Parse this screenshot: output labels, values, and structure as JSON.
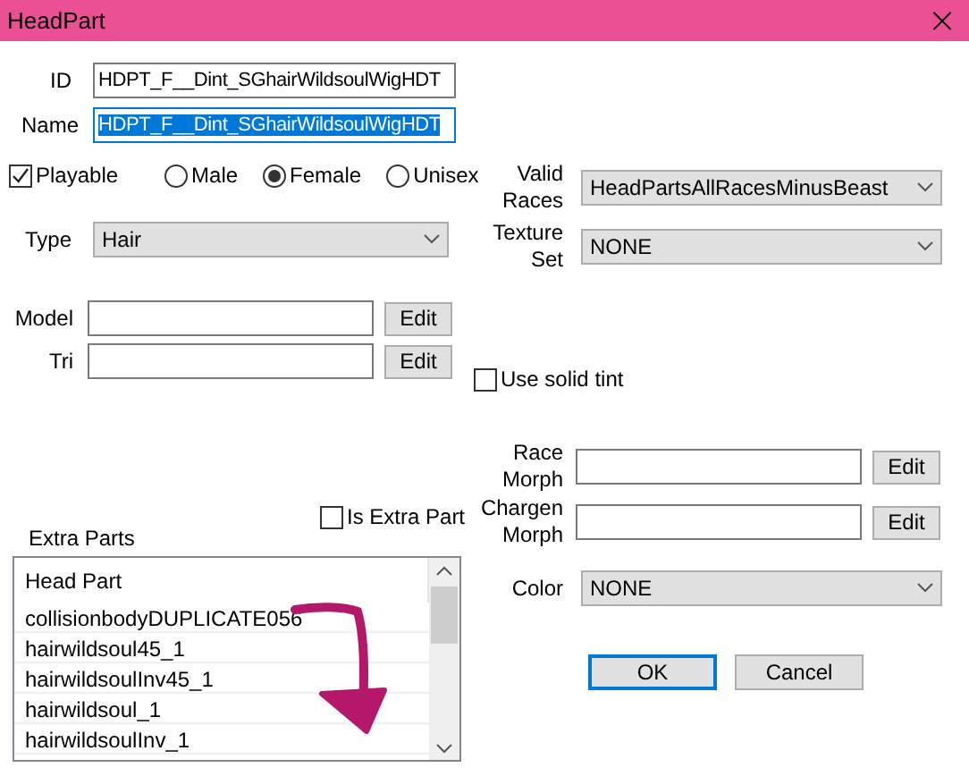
{
  "window": {
    "title": "HeadPart",
    "close": "×"
  },
  "id": {
    "label": "ID",
    "value": "HDPT_F__Dint_SGhairWildsoulWigHDT"
  },
  "name": {
    "label": "Name",
    "value": "HDPT_F__Dint_SGhairWildsoulWigHDT",
    "text_selected": true
  },
  "playable": {
    "label": "Playable",
    "checked": true
  },
  "sex": [
    {
      "label": "Male",
      "selected": false
    },
    {
      "label": "Female",
      "selected": true
    },
    {
      "label": "Unisex",
      "selected": false
    }
  ],
  "type": {
    "label": "Type",
    "value": "Hair"
  },
  "model": {
    "label": "Model",
    "button": "Edit"
  },
  "tri": {
    "label": "Tri",
    "button": "Edit"
  },
  "is_extra_part": {
    "label": "Is Extra Part",
    "checked": false
  },
  "extra_parts": {
    "label": "Extra Parts",
    "column": "Head Part",
    "rows": [
      {
        "text": "collisionbodyDUPLICATE056",
        "selected": false
      },
      {
        "text": "hairwildsoul45_1",
        "selected": false
      },
      {
        "text": "hairwildsoulInv45_1",
        "selected": false
      },
      {
        "text": "hairwildsoul_1",
        "selected": false
      },
      {
        "text": "hairwildsoulInv_1",
        "selected": false
      }
    ]
  },
  "valid_races": {
    "label": [
      "Valid",
      "Races"
    ],
    "value": "HeadPartsAllRacesMinusBeast"
  },
  "texture_set": {
    "label": [
      "Texture",
      "Set"
    ],
    "value": "NONE"
  },
  "use_solid_tint": {
    "label": "Use solid tint",
    "checked": false
  },
  "race_morph": {
    "label": [
      "Race",
      "Morph"
    ],
    "button": "Edit"
  },
  "chargen_morph": {
    "label": [
      "Chargen",
      "Morph"
    ],
    "button": "Edit"
  },
  "color": {
    "label": [
      "Color"
    ],
    "value": "NONE"
  },
  "buttons": [
    {
      "label": "OK",
      "default": true
    },
    {
      "label": "Cancel",
      "default": false
    }
  ]
}
